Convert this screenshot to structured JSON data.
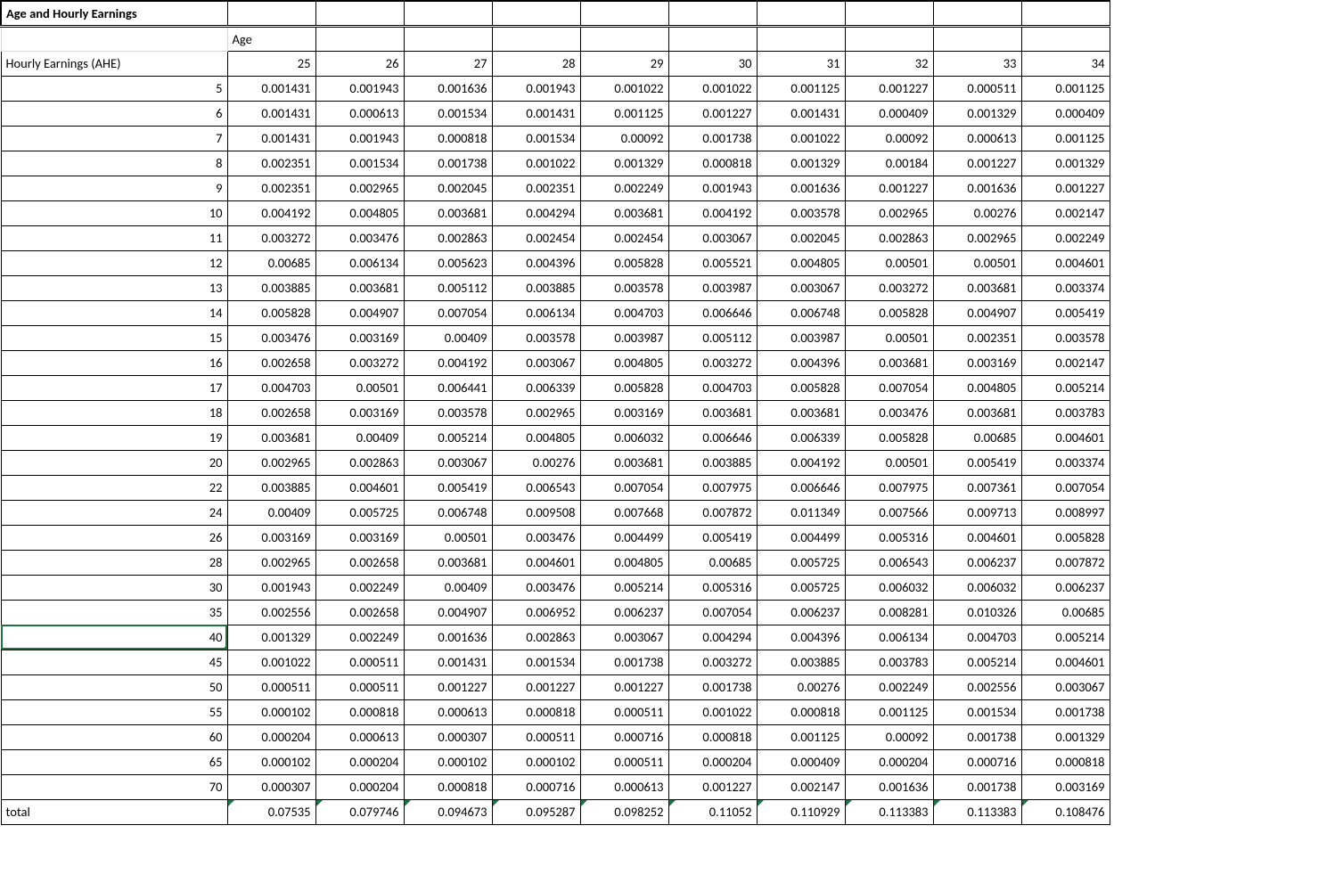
{
  "title": "Age and Hourly Earnings",
  "age_header": "Age",
  "row_header": "Hourly Earnings (AHE)",
  "ages": [
    25,
    26,
    27,
    28,
    29,
    30,
    31,
    32,
    33,
    34
  ],
  "earnings_labels": [
    5,
    6,
    7,
    8,
    9,
    10,
    11,
    12,
    13,
    14,
    15,
    16,
    17,
    18,
    19,
    20,
    22,
    24,
    26,
    28,
    30,
    35,
    40,
    45,
    50,
    55,
    60,
    65,
    70
  ],
  "data": [
    [
      "0.001431",
      "0.001943",
      "0.001636",
      "0.001943",
      "0.001022",
      "0.001022",
      "0.001125",
      "0.001227",
      "0.000511",
      "0.001125"
    ],
    [
      "0.001431",
      "0.000613",
      "0.001534",
      "0.001431",
      "0.001125",
      "0.001227",
      "0.001431",
      "0.000409",
      "0.001329",
      "0.000409"
    ],
    [
      "0.001431",
      "0.001943",
      "0.000818",
      "0.001534",
      "0.00092",
      "0.001738",
      "0.001022",
      "0.00092",
      "0.000613",
      "0.001125"
    ],
    [
      "0.002351",
      "0.001534",
      "0.001738",
      "0.001022",
      "0.001329",
      "0.000818",
      "0.001329",
      "0.00184",
      "0.001227",
      "0.001329"
    ],
    [
      "0.002351",
      "0.002965",
      "0.002045",
      "0.002351",
      "0.002249",
      "0.001943",
      "0.001636",
      "0.001227",
      "0.001636",
      "0.001227"
    ],
    [
      "0.004192",
      "0.004805",
      "0.003681",
      "0.004294",
      "0.003681",
      "0.004192",
      "0.003578",
      "0.002965",
      "0.00276",
      "0.002147"
    ],
    [
      "0.003272",
      "0.003476",
      "0.002863",
      "0.002454",
      "0.002454",
      "0.003067",
      "0.002045",
      "0.002863",
      "0.002965",
      "0.002249"
    ],
    [
      "0.00685",
      "0.006134",
      "0.005623",
      "0.004396",
      "0.005828",
      "0.005521",
      "0.004805",
      "0.00501",
      "0.00501",
      "0.004601"
    ],
    [
      "0.003885",
      "0.003681",
      "0.005112",
      "0.003885",
      "0.003578",
      "0.003987",
      "0.003067",
      "0.003272",
      "0.003681",
      "0.003374"
    ],
    [
      "0.005828",
      "0.004907",
      "0.007054",
      "0.006134",
      "0.004703",
      "0.006646",
      "0.006748",
      "0.005828",
      "0.004907",
      "0.005419"
    ],
    [
      "0.003476",
      "0.003169",
      "0.00409",
      "0.003578",
      "0.003987",
      "0.005112",
      "0.003987",
      "0.00501",
      "0.002351",
      "0.003578"
    ],
    [
      "0.002658",
      "0.003272",
      "0.004192",
      "0.003067",
      "0.004805",
      "0.003272",
      "0.004396",
      "0.003681",
      "0.003169",
      "0.002147"
    ],
    [
      "0.004703",
      "0.00501",
      "0.006441",
      "0.006339",
      "0.005828",
      "0.004703",
      "0.005828",
      "0.007054",
      "0.004805",
      "0.005214"
    ],
    [
      "0.002658",
      "0.003169",
      "0.003578",
      "0.002965",
      "0.003169",
      "0.003681",
      "0.003681",
      "0.003476",
      "0.003681",
      "0.003783"
    ],
    [
      "0.003681",
      "0.00409",
      "0.005214",
      "0.004805",
      "0.006032",
      "0.006646",
      "0.006339",
      "0.005828",
      "0.00685",
      "0.004601"
    ],
    [
      "0.002965",
      "0.002863",
      "0.003067",
      "0.00276",
      "0.003681",
      "0.003885",
      "0.004192",
      "0.00501",
      "0.005419",
      "0.003374"
    ],
    [
      "0.003885",
      "0.004601",
      "0.005419",
      "0.006543",
      "0.007054",
      "0.007975",
      "0.006646",
      "0.007975",
      "0.007361",
      "0.007054"
    ],
    [
      "0.00409",
      "0.005725",
      "0.006748",
      "0.009508",
      "0.007668",
      "0.007872",
      "0.011349",
      "0.007566",
      "0.009713",
      "0.008997"
    ],
    [
      "0.003169",
      "0.003169",
      "0.00501",
      "0.003476",
      "0.004499",
      "0.005419",
      "0.004499",
      "0.005316",
      "0.004601",
      "0.005828"
    ],
    [
      "0.002965",
      "0.002658",
      "0.003681",
      "0.004601",
      "0.004805",
      "0.00685",
      "0.005725",
      "0.006543",
      "0.006237",
      "0.007872"
    ],
    [
      "0.001943",
      "0.002249",
      "0.00409",
      "0.003476",
      "0.005214",
      "0.005316",
      "0.005725",
      "0.006032",
      "0.006032",
      "0.006237"
    ],
    [
      "0.002556",
      "0.002658",
      "0.004907",
      "0.006952",
      "0.006237",
      "0.007054",
      "0.006237",
      "0.008281",
      "0.010326",
      "0.00685"
    ],
    [
      "0.001329",
      "0.002249",
      "0.001636",
      "0.002863",
      "0.003067",
      "0.004294",
      "0.004396",
      "0.006134",
      "0.004703",
      "0.005214"
    ],
    [
      "0.001022",
      "0.000511",
      "0.001431",
      "0.001534",
      "0.001738",
      "0.003272",
      "0.003885",
      "0.003783",
      "0.005214",
      "0.004601"
    ],
    [
      "0.000511",
      "0.000511",
      "0.001227",
      "0.001227",
      "0.001227",
      "0.001738",
      "0.00276",
      "0.002249",
      "0.002556",
      "0.003067"
    ],
    [
      "0.000102",
      "0.000818",
      "0.000613",
      "0.000818",
      "0.000511",
      "0.001022",
      "0.000818",
      "0.001125",
      "0.001534",
      "0.001738"
    ],
    [
      "0.000204",
      "0.000613",
      "0.000307",
      "0.000511",
      "0.000716",
      "0.000818",
      "0.001125",
      "0.00092",
      "0.001738",
      "0.001329"
    ],
    [
      "0.000102",
      "0.000204",
      "0.000102",
      "0.000102",
      "0.000511",
      "0.000204",
      "0.000409",
      "0.000204",
      "0.000716",
      "0.000818"
    ],
    [
      "0.000307",
      "0.000204",
      "0.000818",
      "0.000716",
      "0.000613",
      "0.001227",
      "0.002147",
      "0.001636",
      "0.001738",
      "0.003169"
    ]
  ],
  "total_label": "total",
  "totals": [
    "0.07535",
    "0.079746",
    "0.094673",
    "0.095287",
    "0.098252",
    "0.11052",
    "0.110929",
    "0.113383",
    "0.113383",
    "0.108476"
  ],
  "selected_row_index": 22
}
